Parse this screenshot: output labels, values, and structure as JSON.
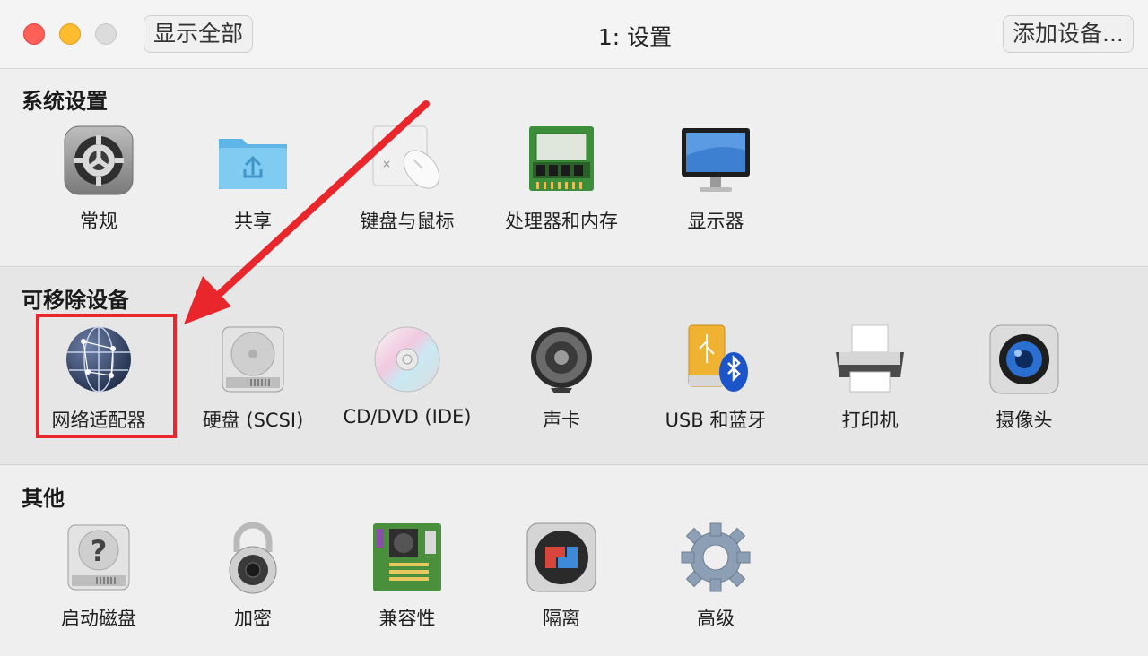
{
  "window": {
    "title": "1: 设置",
    "show_all_label": "显示全部",
    "add_device_label": "添加设备..."
  },
  "sections": {
    "system": {
      "title": "系统设置",
      "items": [
        "常规",
        "共享",
        "键盘与鼠标",
        "处理器和内存",
        "显示器"
      ]
    },
    "removable": {
      "title": "可移除设备",
      "items": [
        "网络适配器",
        "硬盘 (SCSI)",
        "CD/DVD (IDE)",
        "声卡",
        "USB 和蓝牙",
        "打印机",
        "摄像头"
      ]
    },
    "other": {
      "title": "其他",
      "items": [
        "启动磁盘",
        "加密",
        "兼容性",
        "隔离",
        "高级"
      ]
    }
  },
  "icons": {
    "system": [
      "gear-icon",
      "shared-folder-icon",
      "keyboard-mouse-icon",
      "memory-chip-icon",
      "display-icon"
    ],
    "removable": [
      "network-globe-icon",
      "hard-disk-icon",
      "cd-dvd-icon",
      "speaker-icon",
      "usb-bluetooth-icon",
      "printer-icon",
      "camera-icon"
    ],
    "other": [
      "startup-disk-icon",
      "padlock-icon",
      "motherboard-icon",
      "isolation-icon",
      "advanced-gear-icon"
    ]
  },
  "colors": {
    "annotation_red": "#e8262b",
    "close": "#fe5f57",
    "minimize": "#febc2e",
    "zoom": "#dcdcdc"
  }
}
